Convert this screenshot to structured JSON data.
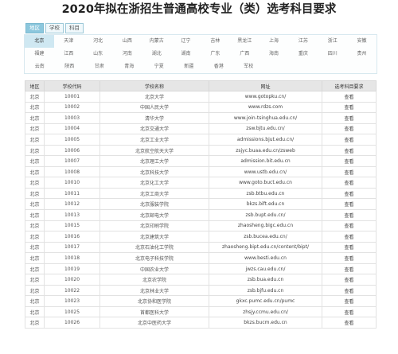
{
  "title": "2020年拟在浙招生普通高校专业（类）选考科目要求",
  "tabs": [
    "地区",
    "学校",
    "科目"
  ],
  "regions": [
    [
      "北京",
      "天津",
      "河北",
      "山西",
      "内蒙古",
      "辽宁",
      "吉林",
      "黑龙江",
      "上海",
      "江苏",
      "浙江",
      "安徽"
    ],
    [
      "福建",
      "江西",
      "山东",
      "河南",
      "湖北",
      "湖南",
      "广东",
      "广西",
      "海南",
      "重庆",
      "四川",
      "贵州"
    ],
    [
      "云南",
      "陕西",
      "甘肃",
      "青海",
      "宁夏",
      "新疆",
      "香港",
      "军校"
    ]
  ],
  "table": {
    "headers": [
      "地区",
      "学校代码",
      "学校名称",
      "网址",
      "选考科目要求"
    ],
    "rows": [
      [
        "北京",
        "10001",
        "北京大学",
        "www.gotopku.cn/",
        "查看"
      ],
      [
        "北京",
        "10002",
        "中国人民大学",
        "www.rdzs.com",
        "查看"
      ],
      [
        "北京",
        "10003",
        "清华大学",
        "www.join-tsinghua.edu.cn/",
        "查看"
      ],
      [
        "北京",
        "10004",
        "北京交通大学",
        "zsw.bjtu.edu.cn/",
        "查看"
      ],
      [
        "北京",
        "10005",
        "北京工业大学",
        "admissions.bjut.edu.cn/",
        "查看"
      ],
      [
        "北京",
        "10006",
        "北京航空航天大学",
        "zsjyc.buaa.edu.cn/zsweb",
        "查看"
      ],
      [
        "北京",
        "10007",
        "北京理工大学",
        "admission.bit.edu.cn",
        "查看"
      ],
      [
        "北京",
        "10008",
        "北京科技大学",
        "www.ustb.edu.cn/",
        "查看"
      ],
      [
        "北京",
        "10010",
        "北京化工大学",
        "www.goto.buct.edu.cn",
        "查看"
      ],
      [
        "北京",
        "10011",
        "北京工商大学",
        "zsb.btbu.edu.cn",
        "查看"
      ],
      [
        "北京",
        "10012",
        "北京服装学院",
        "bkzs.bift.edu.cn",
        "查看"
      ],
      [
        "北京",
        "10013",
        "北京邮电大学",
        "zsb.bupt.edu.cn/",
        "查看"
      ],
      [
        "北京",
        "10015",
        "北京印刷学院",
        "zhaosheng.bigc.edu.cn",
        "查看"
      ],
      [
        "北京",
        "10016",
        "北京建筑大学",
        "zsb.bucea.edu.cn/",
        "查看"
      ],
      [
        "北京",
        "10017",
        "北京石油化工学院",
        "zhaosheng.bipt.edu.cn/content/bipt/",
        "查看"
      ],
      [
        "北京",
        "10018",
        "北京电子科技学院",
        "www.besti.edu.cn",
        "查看"
      ],
      [
        "北京",
        "10019",
        "中国农业大学",
        "jwzs.cau.edu.cn/",
        "查看"
      ],
      [
        "北京",
        "10020",
        "北京农学院",
        "zsb.bua.edu.cn",
        "查看"
      ],
      [
        "北京",
        "10022",
        "北京林业大学",
        "zsb.bjfu.edu.cn",
        "查看"
      ],
      [
        "北京",
        "10023",
        "北京协和医学院",
        "gkxc.pumc.edu.cn/pumc",
        "查看"
      ],
      [
        "北京",
        "10025",
        "首都医科大学",
        "zhsjy.ccmu.edu.cn/",
        "查看"
      ],
      [
        "北京",
        "10026",
        "北京中医药大学",
        "bkzs.bucm.edu.cn",
        "查看"
      ]
    ]
  }
}
